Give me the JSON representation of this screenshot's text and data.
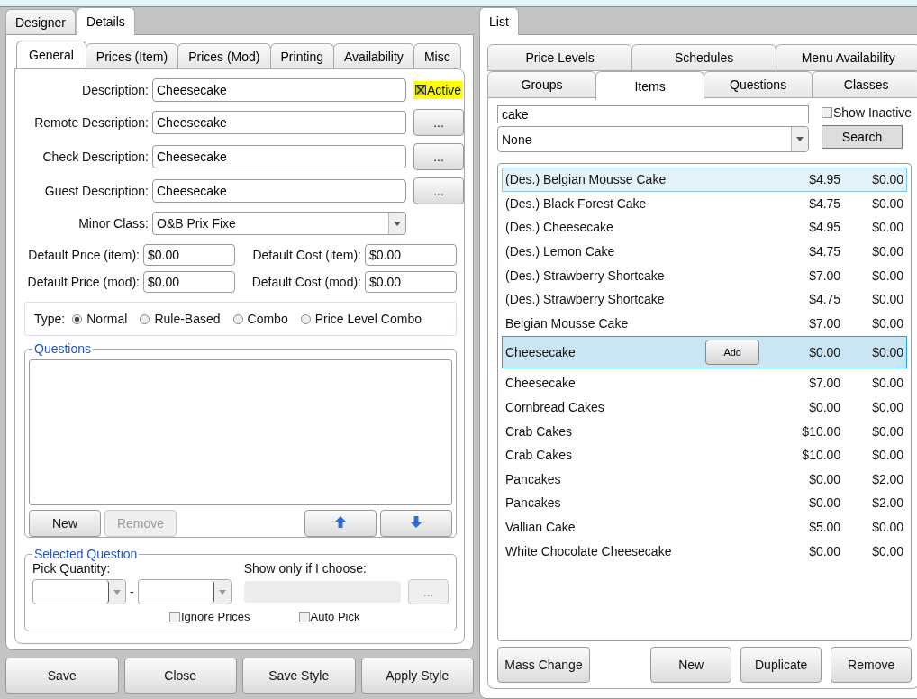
{
  "left_tabs": [
    {
      "label": "Designer",
      "selected": false
    },
    {
      "label": "Details",
      "selected": true
    }
  ],
  "detail_tabs": [
    {
      "label": "General",
      "selected": true
    },
    {
      "label": "Prices (Item)",
      "selected": false
    },
    {
      "label": "Prices (Mod)",
      "selected": false
    },
    {
      "label": "Printing",
      "selected": false
    },
    {
      "label": "Availability",
      "selected": false
    },
    {
      "label": "Misc",
      "selected": false
    }
  ],
  "descriptions": [
    {
      "label": "Description:",
      "value": "Cheesecake",
      "kind": "active",
      "check_label": "Active",
      "checked": true
    },
    {
      "label": "Remote Description:",
      "value": "Cheesecake",
      "kind": "browse",
      "button": "..."
    },
    {
      "label": "Check Description:",
      "value": "Cheesecake",
      "kind": "browse",
      "button": "..."
    },
    {
      "label": "Guest Description:",
      "value": "Cheesecake",
      "kind": "browse",
      "button": "..."
    }
  ],
  "minor_class": {
    "label": "Minor Class:",
    "value": "O&B Prix Fixe"
  },
  "prices": [
    {
      "label": "Default Price (item):",
      "value": "$0.00"
    },
    {
      "label": "Default Cost (item):",
      "value": "$0.00"
    },
    {
      "label": "Default Price (mod):",
      "value": "$0.00"
    },
    {
      "label": "Default Cost (mod):",
      "value": "$0.00"
    }
  ],
  "type": {
    "label": "Type:",
    "options": [
      {
        "label": "Normal",
        "selected": true
      },
      {
        "label": "Rule-Based",
        "selected": false
      },
      {
        "label": "Combo",
        "selected": false
      },
      {
        "label": "Price Level Combo",
        "selected": false
      }
    ]
  },
  "questions": {
    "title": "Questions",
    "buttons": [
      {
        "kind": "text",
        "label": "New",
        "disabled": false
      },
      {
        "kind": "text",
        "label": "Remove",
        "disabled": true
      },
      {
        "kind": "up",
        "disabled": false
      },
      {
        "kind": "down",
        "disabled": false
      }
    ]
  },
  "selected_question": {
    "title": "Selected Question",
    "pick_label": "Pick Quantity:",
    "separator": "-",
    "show_label": "Show only if I choose:",
    "browse": "...",
    "checkboxes": [
      {
        "label": "Ignore Prices",
        "checked": false
      },
      {
        "label": "Auto Pick",
        "checked": false
      }
    ]
  },
  "bottom_buttons": [
    "Save",
    "Close",
    "Save Style",
    "Apply Style"
  ],
  "list_panel": {
    "tab": "List",
    "tab_rows": [
      [
        {
          "label": "Price Levels",
          "selected": false
        },
        {
          "label": "Schedules",
          "selected": false
        },
        {
          "label": "Menu Availability",
          "selected": false
        }
      ],
      [
        {
          "label": "Groups",
          "selected": false
        },
        {
          "label": "Items",
          "selected": true
        },
        {
          "label": "Questions",
          "selected": false
        },
        {
          "label": "Classes",
          "selected": false
        }
      ]
    ],
    "search": "cake",
    "show_inactive": {
      "label": "Show Inactive",
      "checked": false
    },
    "filter": "None",
    "search_button": "Search",
    "items": [
      {
        "name": "(Des.) Belgian Mousse Cake",
        "price": "$4.95",
        "cost": "$0.00",
        "selected": false,
        "hovered": true
      },
      {
        "name": "(Des.) Black Forest Cake",
        "price": "$4.75",
        "cost": "$0.00",
        "selected": false,
        "hovered": false
      },
      {
        "name": "(Des.) Cheesecake",
        "price": "$4.95",
        "cost": "$0.00",
        "selected": false,
        "hovered": false
      },
      {
        "name": "(Des.) Lemon Cake",
        "price": "$4.75",
        "cost": "$0.00",
        "selected": false,
        "hovered": false
      },
      {
        "name": "(Des.) Strawberry Shortcake",
        "price": "$7.00",
        "cost": "$0.00",
        "selected": false,
        "hovered": false
      },
      {
        "name": "(Des.) Strawberry Shortcake",
        "price": "$4.75",
        "cost": "$0.00",
        "selected": false,
        "hovered": false
      },
      {
        "name": "Belgian Mousse Cake",
        "price": "$7.00",
        "cost": "$0.00",
        "selected": false,
        "hovered": false
      },
      {
        "name": "Cheesecake",
        "price": "$0.00",
        "cost": "$0.00",
        "selected": true,
        "hovered": false,
        "action": "Add"
      },
      {
        "name": "Cheesecake",
        "price": "$7.00",
        "cost": "$0.00",
        "selected": false,
        "hovered": false
      },
      {
        "name": "Cornbread Cakes",
        "price": "$0.00",
        "cost": "$0.00",
        "selected": false,
        "hovered": false
      },
      {
        "name": "Crab Cakes",
        "price": "$10.00",
        "cost": "$0.00",
        "selected": false,
        "hovered": false
      },
      {
        "name": "Crab Cakes",
        "price": "$10.00",
        "cost": "$0.00",
        "selected": false,
        "hovered": false
      },
      {
        "name": "Pancakes",
        "price": "$0.00",
        "cost": "$2.00",
        "selected": false,
        "hovered": false
      },
      {
        "name": "Pancakes",
        "price": "$0.00",
        "cost": "$2.00",
        "selected": false,
        "hovered": false
      },
      {
        "name": "Vallian Cake",
        "price": "$5.00",
        "cost": "$0.00",
        "selected": false,
        "hovered": false
      },
      {
        "name": "White Chocolate Cheesecake",
        "price": "$0.00",
        "cost": "$0.00",
        "selected": false,
        "hovered": false
      }
    ],
    "footer_left": "Mass Change",
    "footer_buttons": [
      "New",
      "Duplicate",
      "Remove"
    ]
  }
}
